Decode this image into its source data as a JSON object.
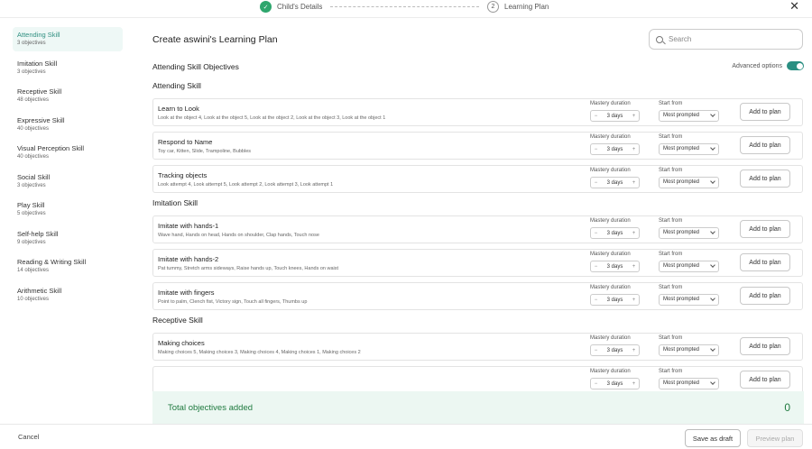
{
  "stepper": {
    "steps": [
      {
        "label": "Child's Details",
        "state": "done",
        "icon": "check-icon"
      },
      {
        "label": "Learning Plan",
        "number": "2",
        "state": "current"
      }
    ],
    "close_icon": "close-icon"
  },
  "sidebar": {
    "items": [
      {
        "name": "Attending Skill",
        "count": "3 objectives",
        "active": true
      },
      {
        "name": "Imitation Skill",
        "count": "3 objectives"
      },
      {
        "name": "Receptive Skill",
        "count": "48 objectives"
      },
      {
        "name": "Expressive Skill",
        "count": "40 objectives"
      },
      {
        "name": "Visual Perception Skill",
        "count": "40 objectives"
      },
      {
        "name": "Social Skill",
        "count": "3 objectives"
      },
      {
        "name": "Play Skill",
        "count": "5 objectives"
      },
      {
        "name": "Self-help Skill",
        "count": "9 objectives"
      },
      {
        "name": "Reading & Writing Skill",
        "count": "14 objectives"
      },
      {
        "name": "Arithmetic Skill",
        "count": "10 objectives"
      }
    ]
  },
  "main": {
    "title": "Create aswini's Learning Plan",
    "search_placeholder": "Search",
    "section_title": "Attending Skill Objectives",
    "advanced_label": "Advanced options",
    "advanced_on": true,
    "field_labels": {
      "mastery": "Mastery duration",
      "start": "Start from"
    },
    "add_label": "Add to plan",
    "groups": [
      {
        "title": "Attending Skill",
        "objectives": [
          {
            "name": "Learn to Look",
            "desc": "Look at the object 4, Look at the object 5, Look at the object 2, Look at the object 3, Look at the object 1",
            "duration": "3 days",
            "start": "Most prompted"
          },
          {
            "name": "Respond to Name",
            "desc": "Toy car, Kitten, Slide, Trampoline, Bubbles",
            "duration": "3 days",
            "start": "Most prompted"
          },
          {
            "name": "Tracking objects",
            "desc": "Look attempt 4, Look attempt 5, Look attempt 2, Look attempt 3, Look attempt 1",
            "duration": "3 days",
            "start": "Most prompted"
          }
        ]
      },
      {
        "title": "Imitation Skill",
        "objectives": [
          {
            "name": "Imitate with hands-1",
            "desc": "Wave hand, Hands on head, Hands on shoulder, Clap hands, Touch nose",
            "duration": "3 days",
            "start": "Most prompted"
          },
          {
            "name": "Imitate with hands-2",
            "desc": "Pat tummy, Stretch arms sideways, Raise hands up, Touch knees, Hands on waist",
            "duration": "3 days",
            "start": "Most prompted"
          },
          {
            "name": "Imitate with fingers",
            "desc": "Point to palm, Clench fist, Victory sign, Touch all fingers, Thumbs up",
            "duration": "3 days",
            "start": "Most prompted"
          }
        ]
      },
      {
        "title": "Receptive Skill",
        "objectives": [
          {
            "name": "Making choices",
            "desc": "Making choices 5, Making choices 3, Making choices 4, Making choices 1, Making choices 2",
            "duration": "3 days",
            "start": "Most prompted"
          },
          {
            "name": "",
            "desc": "",
            "duration": "3 days",
            "start": "Most prompted"
          }
        ]
      }
    ],
    "total_label": "Total objectives added",
    "total_value": "0"
  },
  "footer": {
    "cancel": "Cancel",
    "save_draft": "Save as draft",
    "preview": "Preview plan"
  },
  "colors": {
    "accent": "#2a8f82",
    "success": "#2ea66d",
    "total_bg": "#ecf7f2"
  }
}
